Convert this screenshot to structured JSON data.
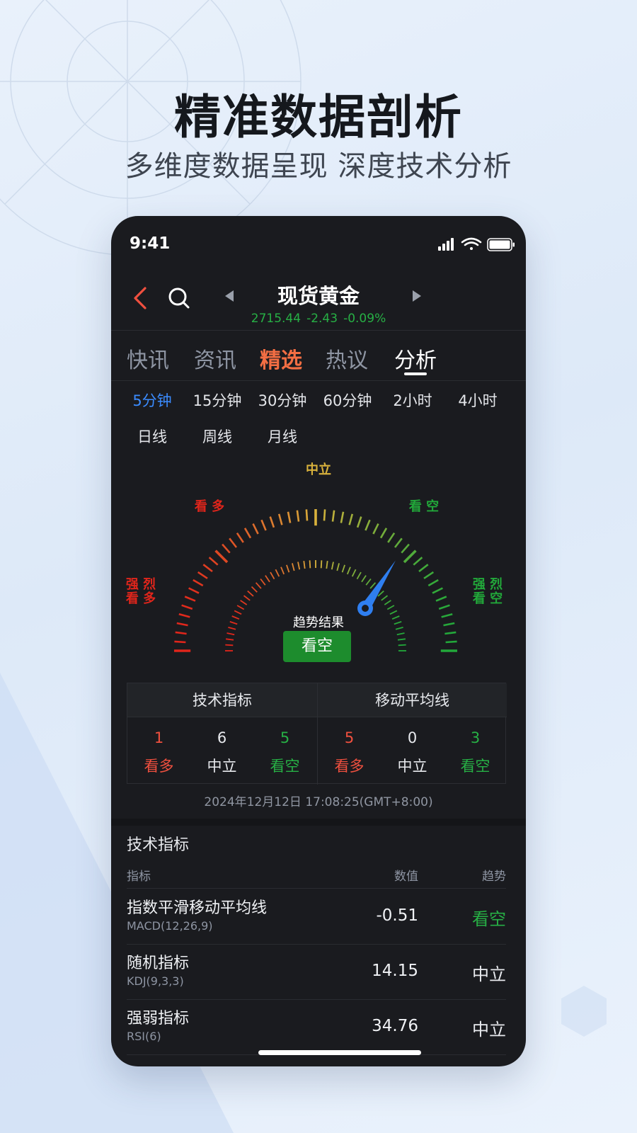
{
  "headline": "精准数据剖析",
  "subline": "多维度数据呈现  深度技术分析",
  "status_bar": {
    "time": "9:41"
  },
  "header": {
    "symbol": "现货黄金",
    "price": "2715.44",
    "change": "-2.43",
    "change_pct": "-0.09%"
  },
  "tabs": [
    {
      "label": "快讯"
    },
    {
      "label": "资讯"
    },
    {
      "label": "精选"
    },
    {
      "label": "热议"
    },
    {
      "label": "分析"
    }
  ],
  "periods": [
    "5分钟",
    "15分钟",
    "30分钟",
    "60分钟",
    "2小时",
    "4小时",
    "日线",
    "周线",
    "月线"
  ],
  "gauge": {
    "labels": {
      "neutral": "中立",
      "buy": "看 多",
      "sell": "看 空",
      "strong_buy": [
        "强 烈",
        "看 多"
      ],
      "strong_sell": [
        "强 烈",
        "看 空"
      ]
    },
    "level": 0.68,
    "result_title": "趋势结果",
    "result": "看空",
    "colors": {
      "buy": "#e0251b",
      "neutral": "#d9b23c",
      "sell": "#22a83a",
      "needle": "#2f7ff0"
    }
  },
  "summary": {
    "tech": {
      "title": "技术指标",
      "cells": [
        {
          "n": "1",
          "label": "看多"
        },
        {
          "n": "6",
          "label": "中立"
        },
        {
          "n": "5",
          "label": "看空"
        }
      ]
    },
    "ma": {
      "title": "移动平均线",
      "cells": [
        {
          "n": "5",
          "label": "看多"
        },
        {
          "n": "0",
          "label": "中立"
        },
        {
          "n": "3",
          "label": "看空"
        }
      ]
    },
    "timestamp": "2024年12月12日 17:08:25(GMT+8:00)"
  },
  "indicators": {
    "title": "技术指标",
    "headers": {
      "name": "指标",
      "value": "数值",
      "trend": "趋势"
    },
    "rows": [
      {
        "name": "指数平滑移动平均线",
        "param": "MACD(12,26,9)",
        "value": "-0.51",
        "trend": "看空"
      },
      {
        "name": "随机指标",
        "param": "KDJ(9,3,3)",
        "value": "14.15",
        "trend": "中立"
      },
      {
        "name": "强弱指标",
        "param": "RSI(6)",
        "value": "34.76",
        "trend": "中立"
      }
    ]
  }
}
